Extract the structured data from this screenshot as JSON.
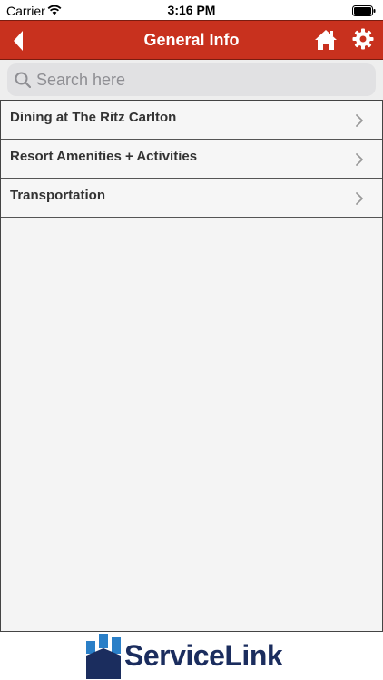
{
  "status_bar": {
    "carrier": "Carrier",
    "time": "3:16 PM"
  },
  "nav": {
    "title": "General Info",
    "back_icon": "chevron-left-icon",
    "home_icon": "home-icon",
    "settings_icon": "gear-icon"
  },
  "search": {
    "placeholder": "Search here",
    "value": ""
  },
  "list": {
    "items": [
      {
        "label": "Dining at The Ritz Carlton"
      },
      {
        "label": "Resort Amenities + Activities"
      },
      {
        "label": "Transportation"
      }
    ]
  },
  "footer": {
    "logo_text": "ServiceLink"
  },
  "colors": {
    "nav_background": "#c8311e",
    "logo_blue": "#1b2d5e",
    "logo_accent": "#2a7fc7"
  }
}
